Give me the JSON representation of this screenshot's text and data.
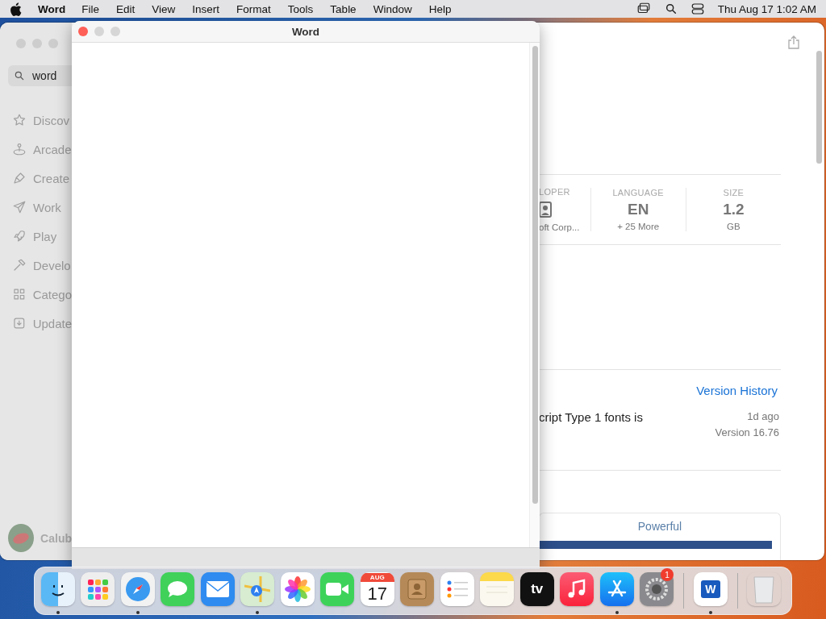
{
  "menu_bar": {
    "app_name": "Word",
    "menus": [
      "File",
      "Edit",
      "View",
      "Insert",
      "Format",
      "Tools",
      "Table",
      "Window",
      "Help"
    ],
    "clock": "Thu Aug 17  1:02 AM"
  },
  "app_store_window": {
    "search": {
      "value": "word"
    },
    "sidebar": {
      "items": [
        {
          "label": "Discov",
          "kind": "star"
        },
        {
          "label": "Arcade",
          "kind": "joystick"
        },
        {
          "label": "Create",
          "kind": "brush"
        },
        {
          "label": "Work",
          "kind": "plane"
        },
        {
          "label": "Play",
          "kind": "rocket"
        },
        {
          "label": "Develo",
          "kind": "hammer"
        },
        {
          "label": "Catego",
          "kind": "grid"
        },
        {
          "label": "Update",
          "kind": "download"
        }
      ],
      "account": "Calub"
    },
    "info": [
      {
        "heading": "LOPER",
        "kind": "icon",
        "detail": "oft Corp..."
      },
      {
        "heading": "LANGUAGE",
        "kind": "value",
        "value": "EN",
        "detail": "+ 25 More"
      },
      {
        "heading": "SIZE",
        "kind": "value",
        "value": "1.2",
        "detail": "GB"
      }
    ],
    "version_history": {
      "link": "Version History",
      "notes": "cript Type 1 fonts is",
      "age": "1d ago",
      "version": "Version 16.76"
    },
    "feature_card": {
      "title": "Powerful"
    }
  },
  "word_window": {
    "title": "Word"
  },
  "dock": {
    "apps": [
      {
        "kind": "finder",
        "running": true
      },
      {
        "kind": "launchpad",
        "running": false
      },
      {
        "kind": "safari",
        "running": true
      },
      {
        "kind": "messages",
        "running": false
      },
      {
        "kind": "mail",
        "running": false
      },
      {
        "kind": "maps",
        "running": true
      },
      {
        "kind": "photos",
        "running": false
      },
      {
        "kind": "facetime",
        "running": false
      },
      {
        "kind": "calendar",
        "running": false,
        "month": "AUG",
        "day": "17"
      },
      {
        "kind": "contacts",
        "running": false
      },
      {
        "kind": "reminders",
        "running": false
      },
      {
        "kind": "notes",
        "running": false
      },
      {
        "kind": "tv",
        "running": false,
        "label": "tv"
      },
      {
        "kind": "music",
        "running": false
      },
      {
        "kind": "appstore",
        "running": true
      },
      {
        "kind": "settings",
        "running": false,
        "badge": "1"
      },
      {
        "kind": "divider"
      },
      {
        "kind": "word",
        "running": true,
        "label": "W"
      },
      {
        "kind": "divider"
      },
      {
        "kind": "trash",
        "running": false
      }
    ]
  }
}
